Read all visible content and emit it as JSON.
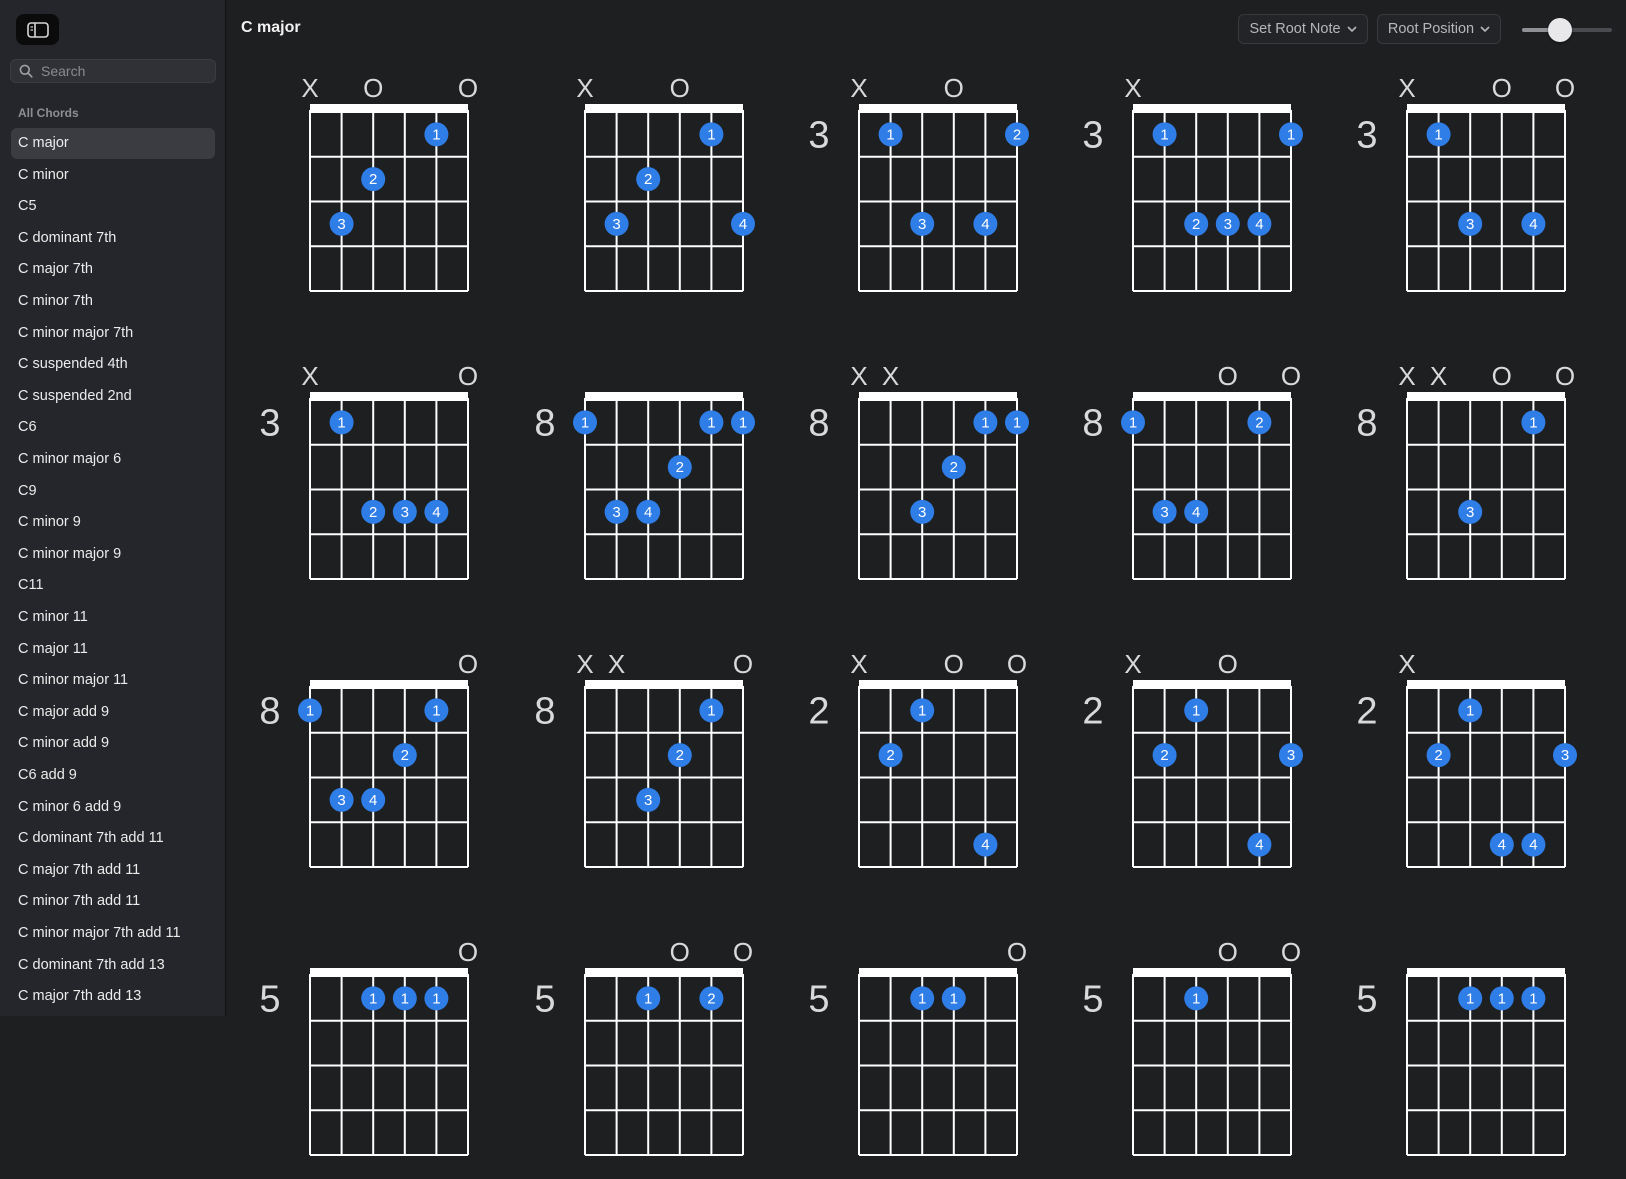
{
  "sidebar": {
    "search_placeholder": "Search",
    "section_label": "All Chords",
    "selected_index": 0,
    "items": [
      "C major",
      "C minor",
      "C5",
      "C dominant 7th",
      "C major 7th",
      "C minor 7th",
      "C minor major 7th",
      "C suspended 4th",
      "C suspended 2nd",
      "C6",
      "C minor major 6",
      "C9",
      "C minor 9",
      "C minor major 9",
      "C11",
      "C minor 11",
      "C major 11",
      "C minor major 11",
      "C major add 9",
      "C minor add 9",
      "C6 add 9",
      "C minor 6 add 9",
      "C dominant 7th add 11",
      "C major 7th add 11",
      "C minor 7th add 11",
      "C minor major 7th add 11",
      "C dominant 7th add 13",
      "C major 7th add 13"
    ]
  },
  "toolbar": {
    "title": "C major",
    "root_note_label": "Set Root Note",
    "position_label": "Root Position",
    "zoom_level": 0.42
  },
  "colors": {
    "accent": "#2f7de6",
    "background": "#1e1f21",
    "sidebar": "#25262b"
  },
  "chords": [
    {
      "fret": "",
      "marks": [
        "X",
        "",
        "O",
        "",
        "",
        "O"
      ],
      "dots": [
        {
          "s": 5,
          "f": 1,
          "n": "1"
        },
        {
          "s": 3,
          "f": 2,
          "n": "2"
        },
        {
          "s": 2,
          "f": 3,
          "n": "3"
        }
      ]
    },
    {
      "fret": "",
      "marks": [
        "X",
        "",
        "",
        "O",
        "",
        ""
      ],
      "dots": [
        {
          "s": 5,
          "f": 1,
          "n": "1"
        },
        {
          "s": 3,
          "f": 2,
          "n": "2"
        },
        {
          "s": 2,
          "f": 3,
          "n": "3"
        },
        {
          "s": 6,
          "f": 3,
          "n": "4"
        }
      ]
    },
    {
      "fret": "3",
      "marks": [
        "X",
        "",
        "",
        "O",
        "",
        ""
      ],
      "dots": [
        {
          "s": 2,
          "f": 1,
          "n": "1"
        },
        {
          "s": 6,
          "f": 1,
          "n": "2"
        },
        {
          "s": 3,
          "f": 3,
          "n": "3"
        },
        {
          "s": 5,
          "f": 3,
          "n": "4"
        }
      ]
    },
    {
      "fret": "3",
      "marks": [
        "X",
        "",
        "",
        "",
        "",
        ""
      ],
      "dots": [
        {
          "s": 2,
          "f": 1,
          "n": "1"
        },
        {
          "s": 6,
          "f": 1,
          "n": "1"
        },
        {
          "s": 3,
          "f": 3,
          "n": "2"
        },
        {
          "s": 4,
          "f": 3,
          "n": "3"
        },
        {
          "s": 5,
          "f": 3,
          "n": "4"
        }
      ]
    },
    {
      "fret": "3",
      "marks": [
        "X",
        "",
        "",
        "O",
        "",
        "O"
      ],
      "dots": [
        {
          "s": 2,
          "f": 1,
          "n": "1"
        },
        {
          "s": 3,
          "f": 3,
          "n": "3"
        },
        {
          "s": 5,
          "f": 3,
          "n": "4"
        }
      ]
    },
    {
      "fret": "3",
      "marks": [
        "X",
        "",
        "",
        "",
        "",
        "O"
      ],
      "dots": [
        {
          "s": 2,
          "f": 1,
          "n": "1"
        },
        {
          "s": 3,
          "f": 3,
          "n": "2"
        },
        {
          "s": 4,
          "f": 3,
          "n": "3"
        },
        {
          "s": 5,
          "f": 3,
          "n": "4"
        }
      ]
    },
    {
      "fret": "8",
      "marks": [
        "",
        "",
        "",
        "",
        "",
        ""
      ],
      "dots": [
        {
          "s": 1,
          "f": 1,
          "n": "1"
        },
        {
          "s": 5,
          "f": 1,
          "n": "1"
        },
        {
          "s": 6,
          "f": 1,
          "n": "1"
        },
        {
          "s": 4,
          "f": 2,
          "n": "2"
        },
        {
          "s": 2,
          "f": 3,
          "n": "3"
        },
        {
          "s": 3,
          "f": 3,
          "n": "4"
        }
      ]
    },
    {
      "fret": "8",
      "marks": [
        "X",
        "X",
        "",
        "",
        "",
        ""
      ],
      "dots": [
        {
          "s": 5,
          "f": 1,
          "n": "1"
        },
        {
          "s": 6,
          "f": 1,
          "n": "1"
        },
        {
          "s": 4,
          "f": 2,
          "n": "2"
        },
        {
          "s": 3,
          "f": 3,
          "n": "3"
        }
      ]
    },
    {
      "fret": "8",
      "marks": [
        "",
        "",
        "",
        "O",
        "",
        "O"
      ],
      "dots": [
        {
          "s": 1,
          "f": 1,
          "n": "1"
        },
        {
          "s": 5,
          "f": 1,
          "n": "2"
        },
        {
          "s": 2,
          "f": 3,
          "n": "3"
        },
        {
          "s": 3,
          "f": 3,
          "n": "4"
        }
      ]
    },
    {
      "fret": "8",
      "marks": [
        "X",
        "X",
        "",
        "O",
        "",
        "O"
      ],
      "dots": [
        {
          "s": 5,
          "f": 1,
          "n": "1"
        },
        {
          "s": 3,
          "f": 3,
          "n": "3"
        }
      ]
    },
    {
      "fret": "8",
      "marks": [
        "",
        "",
        "",
        "",
        "",
        "O"
      ],
      "dots": [
        {
          "s": 1,
          "f": 1,
          "n": "1"
        },
        {
          "s": 5,
          "f": 1,
          "n": "1"
        },
        {
          "s": 4,
          "f": 2,
          "n": "2"
        },
        {
          "s": 2,
          "f": 3,
          "n": "3"
        },
        {
          "s": 3,
          "f": 3,
          "n": "4"
        }
      ]
    },
    {
      "fret": "8",
      "marks": [
        "X",
        "X",
        "",
        "",
        "",
        "O"
      ],
      "dots": [
        {
          "s": 5,
          "f": 1,
          "n": "1"
        },
        {
          "s": 4,
          "f": 2,
          "n": "2"
        },
        {
          "s": 3,
          "f": 3,
          "n": "3"
        }
      ]
    },
    {
      "fret": "2",
      "marks": [
        "X",
        "",
        "",
        "O",
        "",
        "O"
      ],
      "dots": [
        {
          "s": 3,
          "f": 1,
          "n": "1"
        },
        {
          "s": 2,
          "f": 2,
          "n": "2"
        },
        {
          "s": 5,
          "f": 4,
          "n": "4"
        }
      ]
    },
    {
      "fret": "2",
      "marks": [
        "X",
        "",
        "",
        "O",
        "",
        ""
      ],
      "dots": [
        {
          "s": 3,
          "f": 1,
          "n": "1"
        },
        {
          "s": 2,
          "f": 2,
          "n": "2"
        },
        {
          "s": 6,
          "f": 2,
          "n": "3"
        },
        {
          "s": 5,
          "f": 4,
          "n": "4"
        }
      ]
    },
    {
      "fret": "2",
      "marks": [
        "X",
        "",
        "",
        "",
        "",
        ""
      ],
      "dots": [
        {
          "s": 3,
          "f": 1,
          "n": "1"
        },
        {
          "s": 2,
          "f": 2,
          "n": "2"
        },
        {
          "s": 6,
          "f": 2,
          "n": "3"
        },
        {
          "s": 4,
          "f": 4,
          "n": "4"
        },
        {
          "s": 5,
          "f": 4,
          "n": "4"
        }
      ]
    },
    {
      "fret": "5",
      "marks": [
        "",
        "",
        "",
        "",
        "",
        "O"
      ],
      "dots": [
        {
          "s": 3,
          "f": 1,
          "n": "1"
        },
        {
          "s": 4,
          "f": 1,
          "n": "1"
        },
        {
          "s": 5,
          "f": 1,
          "n": "1"
        }
      ]
    },
    {
      "fret": "5",
      "marks": [
        "",
        "",
        "",
        "O",
        "",
        "O"
      ],
      "dots": [
        {
          "s": 3,
          "f": 1,
          "n": "1"
        },
        {
          "s": 5,
          "f": 1,
          "n": "2"
        }
      ]
    },
    {
      "fret": "5",
      "marks": [
        "",
        "",
        "",
        "",
        "",
        "O"
      ],
      "dots": [
        {
          "s": 3,
          "f": 1,
          "n": "1"
        },
        {
          "s": 4,
          "f": 1,
          "n": "1"
        }
      ]
    },
    {
      "fret": "5",
      "marks": [
        "",
        "",
        "",
        "O",
        "",
        "O"
      ],
      "dots": [
        {
          "s": 3,
          "f": 1,
          "n": "1"
        }
      ]
    },
    {
      "fret": "5",
      "marks": [
        "",
        "",
        "",
        "",
        "",
        ""
      ],
      "dots": [
        {
          "s": 3,
          "f": 1,
          "n": "1"
        },
        {
          "s": 4,
          "f": 1,
          "n": "1"
        },
        {
          "s": 5,
          "f": 1,
          "n": "1"
        }
      ]
    }
  ]
}
